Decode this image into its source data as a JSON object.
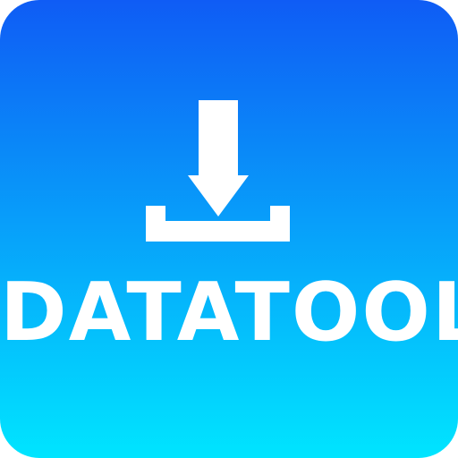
{
  "icon": {
    "name": "download-icon",
    "app_name": "DATATOOL",
    "colors": {
      "gradient_top": "#0f5cf5",
      "gradient_bottom": "#00e5ff",
      "glyph": "#ffffff",
      "text": "#ffffff"
    }
  }
}
